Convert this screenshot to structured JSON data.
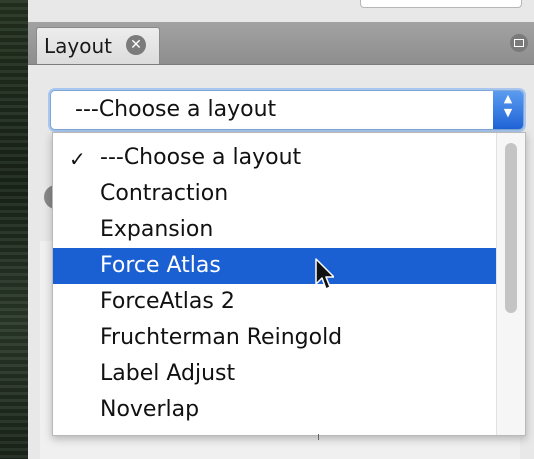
{
  "panel": {
    "tab_title": "Layout",
    "close_icon": "close-circle-icon",
    "minimize_icon": "minimize-icon"
  },
  "layout_select": {
    "selected_value": "---Choose a layout",
    "arrows_icon": "up-down-chevron-icon"
  },
  "dropdown": {
    "checkmark": "✓",
    "options": [
      {
        "label": "---Choose a layout",
        "checked": true,
        "highlighted": false
      },
      {
        "label": "Contraction",
        "checked": false,
        "highlighted": false
      },
      {
        "label": "Expansion",
        "checked": false,
        "highlighted": false
      },
      {
        "label": "Force Atlas",
        "checked": false,
        "highlighted": true
      },
      {
        "label": "ForceAtlas 2",
        "checked": false,
        "highlighted": false
      },
      {
        "label": "Fruchterman Reingold",
        "checked": false,
        "highlighted": false
      },
      {
        "label": "Label Adjust",
        "checked": false,
        "highlighted": false
      },
      {
        "label": "Noverlap",
        "checked": false,
        "highlighted": false
      }
    ]
  },
  "colors": {
    "highlight": "#1a60d3",
    "select_arrows": "#2f74e0",
    "focus_ring": "#a9c7ee"
  }
}
